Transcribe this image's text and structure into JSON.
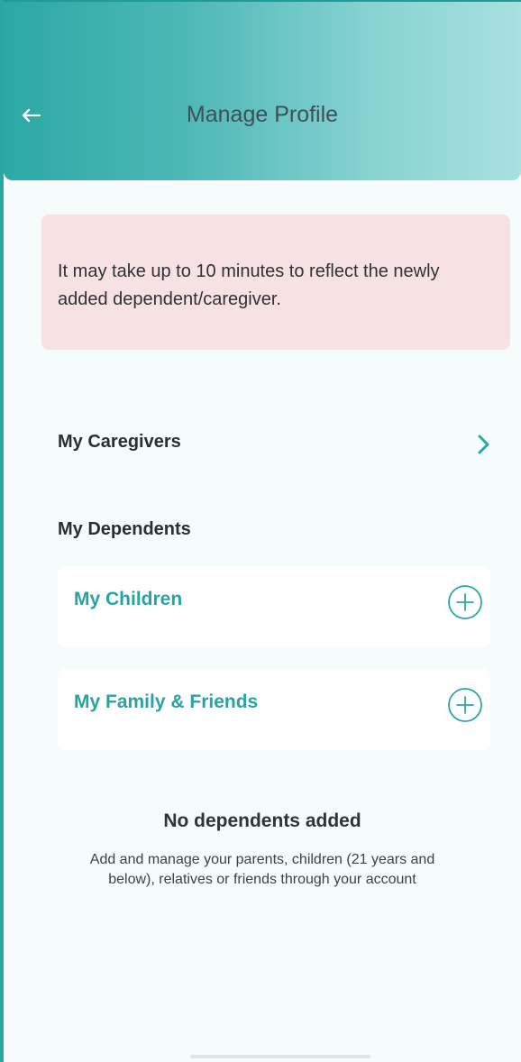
{
  "header": {
    "title": "Manage Profile",
    "back_icon": "arrow-left-icon",
    "gradient_colors": [
      "#2ba8a5",
      "#4db8b5",
      "#85d2d1",
      "#a8e1df"
    ]
  },
  "notice": {
    "text": "It may take up to 10 minutes to reflect the newly added dependent/caregiver.",
    "background": "#f8e1e3"
  },
  "caregivers": {
    "label": "My Caregivers",
    "icon": "chevron-right-icon"
  },
  "dependents": {
    "label": "My Dependents",
    "cards": [
      {
        "label": "My Children",
        "icon": "plus-circle-icon"
      },
      {
        "label": "My Family & Friends",
        "icon": "plus-circle-icon"
      }
    ]
  },
  "empty_state": {
    "title": "No dependents added",
    "description": "Add and manage your parents, children (21 years and below), relatives or friends through your account"
  },
  "colors": {
    "accent": "#27a4a1",
    "text_dark": "#2a2f34"
  }
}
